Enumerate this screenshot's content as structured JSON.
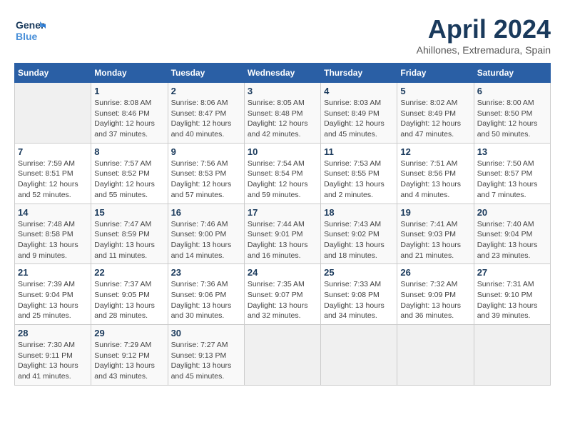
{
  "header": {
    "logo_line1": "General",
    "logo_line2": "Blue",
    "month": "April 2024",
    "location": "Ahillones, Extremadura, Spain"
  },
  "weekdays": [
    "Sunday",
    "Monday",
    "Tuesday",
    "Wednesday",
    "Thursday",
    "Friday",
    "Saturday"
  ],
  "weeks": [
    [
      {
        "day": "",
        "sunrise": "",
        "sunset": "",
        "daylight": ""
      },
      {
        "day": "1",
        "sunrise": "Sunrise: 8:08 AM",
        "sunset": "Sunset: 8:46 PM",
        "daylight": "Daylight: 12 hours and 37 minutes."
      },
      {
        "day": "2",
        "sunrise": "Sunrise: 8:06 AM",
        "sunset": "Sunset: 8:47 PM",
        "daylight": "Daylight: 12 hours and 40 minutes."
      },
      {
        "day": "3",
        "sunrise": "Sunrise: 8:05 AM",
        "sunset": "Sunset: 8:48 PM",
        "daylight": "Daylight: 12 hours and 42 minutes."
      },
      {
        "day": "4",
        "sunrise": "Sunrise: 8:03 AM",
        "sunset": "Sunset: 8:49 PM",
        "daylight": "Daylight: 12 hours and 45 minutes."
      },
      {
        "day": "5",
        "sunrise": "Sunrise: 8:02 AM",
        "sunset": "Sunset: 8:49 PM",
        "daylight": "Daylight: 12 hours and 47 minutes."
      },
      {
        "day": "6",
        "sunrise": "Sunrise: 8:00 AM",
        "sunset": "Sunset: 8:50 PM",
        "daylight": "Daylight: 12 hours and 50 minutes."
      }
    ],
    [
      {
        "day": "7",
        "sunrise": "Sunrise: 7:59 AM",
        "sunset": "Sunset: 8:51 PM",
        "daylight": "Daylight: 12 hours and 52 minutes."
      },
      {
        "day": "8",
        "sunrise": "Sunrise: 7:57 AM",
        "sunset": "Sunset: 8:52 PM",
        "daylight": "Daylight: 12 hours and 55 minutes."
      },
      {
        "day": "9",
        "sunrise": "Sunrise: 7:56 AM",
        "sunset": "Sunset: 8:53 PM",
        "daylight": "Daylight: 12 hours and 57 minutes."
      },
      {
        "day": "10",
        "sunrise": "Sunrise: 7:54 AM",
        "sunset": "Sunset: 8:54 PM",
        "daylight": "Daylight: 12 hours and 59 minutes."
      },
      {
        "day": "11",
        "sunrise": "Sunrise: 7:53 AM",
        "sunset": "Sunset: 8:55 PM",
        "daylight": "Daylight: 13 hours and 2 minutes."
      },
      {
        "day": "12",
        "sunrise": "Sunrise: 7:51 AM",
        "sunset": "Sunset: 8:56 PM",
        "daylight": "Daylight: 13 hours and 4 minutes."
      },
      {
        "day": "13",
        "sunrise": "Sunrise: 7:50 AM",
        "sunset": "Sunset: 8:57 PM",
        "daylight": "Daylight: 13 hours and 7 minutes."
      }
    ],
    [
      {
        "day": "14",
        "sunrise": "Sunrise: 7:48 AM",
        "sunset": "Sunset: 8:58 PM",
        "daylight": "Daylight: 13 hours and 9 minutes."
      },
      {
        "day": "15",
        "sunrise": "Sunrise: 7:47 AM",
        "sunset": "Sunset: 8:59 PM",
        "daylight": "Daylight: 13 hours and 11 minutes."
      },
      {
        "day": "16",
        "sunrise": "Sunrise: 7:46 AM",
        "sunset": "Sunset: 9:00 PM",
        "daylight": "Daylight: 13 hours and 14 minutes."
      },
      {
        "day": "17",
        "sunrise": "Sunrise: 7:44 AM",
        "sunset": "Sunset: 9:01 PM",
        "daylight": "Daylight: 13 hours and 16 minutes."
      },
      {
        "day": "18",
        "sunrise": "Sunrise: 7:43 AM",
        "sunset": "Sunset: 9:02 PM",
        "daylight": "Daylight: 13 hours and 18 minutes."
      },
      {
        "day": "19",
        "sunrise": "Sunrise: 7:41 AM",
        "sunset": "Sunset: 9:03 PM",
        "daylight": "Daylight: 13 hours and 21 minutes."
      },
      {
        "day": "20",
        "sunrise": "Sunrise: 7:40 AM",
        "sunset": "Sunset: 9:04 PM",
        "daylight": "Daylight: 13 hours and 23 minutes."
      }
    ],
    [
      {
        "day": "21",
        "sunrise": "Sunrise: 7:39 AM",
        "sunset": "Sunset: 9:04 PM",
        "daylight": "Daylight: 13 hours and 25 minutes."
      },
      {
        "day": "22",
        "sunrise": "Sunrise: 7:37 AM",
        "sunset": "Sunset: 9:05 PM",
        "daylight": "Daylight: 13 hours and 28 minutes."
      },
      {
        "day": "23",
        "sunrise": "Sunrise: 7:36 AM",
        "sunset": "Sunset: 9:06 PM",
        "daylight": "Daylight: 13 hours and 30 minutes."
      },
      {
        "day": "24",
        "sunrise": "Sunrise: 7:35 AM",
        "sunset": "Sunset: 9:07 PM",
        "daylight": "Daylight: 13 hours and 32 minutes."
      },
      {
        "day": "25",
        "sunrise": "Sunrise: 7:33 AM",
        "sunset": "Sunset: 9:08 PM",
        "daylight": "Daylight: 13 hours and 34 minutes."
      },
      {
        "day": "26",
        "sunrise": "Sunrise: 7:32 AM",
        "sunset": "Sunset: 9:09 PM",
        "daylight": "Daylight: 13 hours and 36 minutes."
      },
      {
        "day": "27",
        "sunrise": "Sunrise: 7:31 AM",
        "sunset": "Sunset: 9:10 PM",
        "daylight": "Daylight: 13 hours and 39 minutes."
      }
    ],
    [
      {
        "day": "28",
        "sunrise": "Sunrise: 7:30 AM",
        "sunset": "Sunset: 9:11 PM",
        "daylight": "Daylight: 13 hours and 41 minutes."
      },
      {
        "day": "29",
        "sunrise": "Sunrise: 7:29 AM",
        "sunset": "Sunset: 9:12 PM",
        "daylight": "Daylight: 13 hours and 43 minutes."
      },
      {
        "day": "30",
        "sunrise": "Sunrise: 7:27 AM",
        "sunset": "Sunset: 9:13 PM",
        "daylight": "Daylight: 13 hours and 45 minutes."
      },
      {
        "day": "",
        "sunrise": "",
        "sunset": "",
        "daylight": ""
      },
      {
        "day": "",
        "sunrise": "",
        "sunset": "",
        "daylight": ""
      },
      {
        "day": "",
        "sunrise": "",
        "sunset": "",
        "daylight": ""
      },
      {
        "day": "",
        "sunrise": "",
        "sunset": "",
        "daylight": ""
      }
    ]
  ]
}
